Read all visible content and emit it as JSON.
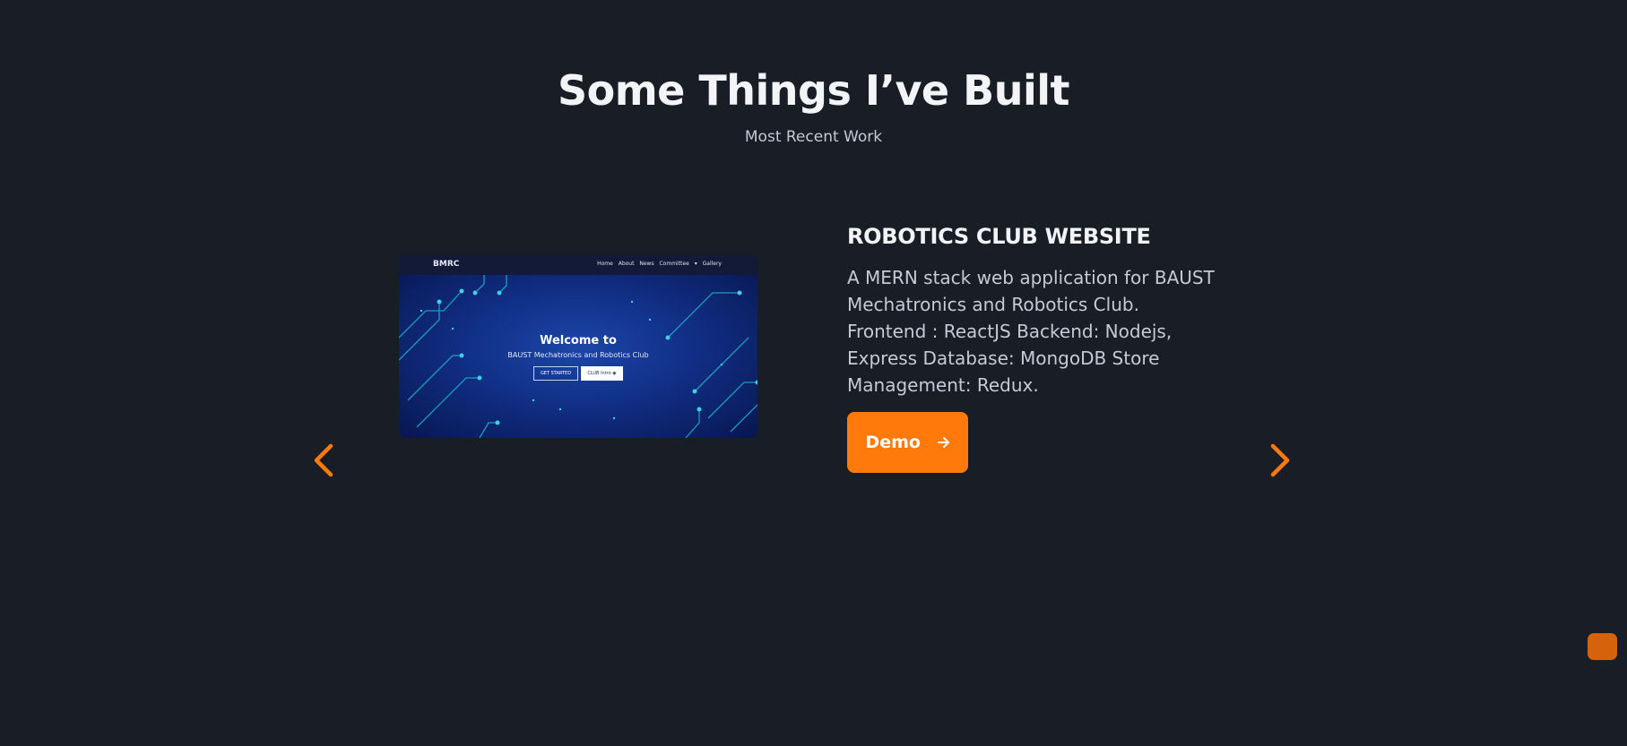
{
  "section": {
    "title": "Some Things I’ve Built",
    "subtitle": "Most Recent Work"
  },
  "project": {
    "title": "ROBOTICS CLUB WEBSITE",
    "description": "A MERN stack web application for BAUST Mechatronics and Robotics Club. Frontend : ReactJS Backend: Nodejs, Express Database: MongoDB Store Management: Redux.",
    "demo_label": "Demo",
    "screenshot": {
      "logo": "BMRC",
      "nav_links": "Home About News Committee ▾ Gallery",
      "welcome": "Welcome to",
      "club_name": "BAUST Mechatronics and Robotics Club",
      "button_primary": "GET STARTED",
      "button_secondary": "CLUB Intro ◉"
    }
  },
  "carousel": {
    "prev_icon": "chevron-left-icon",
    "next_icon": "chevron-right-icon"
  },
  "colors": {
    "background": "#181d26",
    "accent": "#ff7a0b",
    "scroll_button": "#d6630b"
  }
}
